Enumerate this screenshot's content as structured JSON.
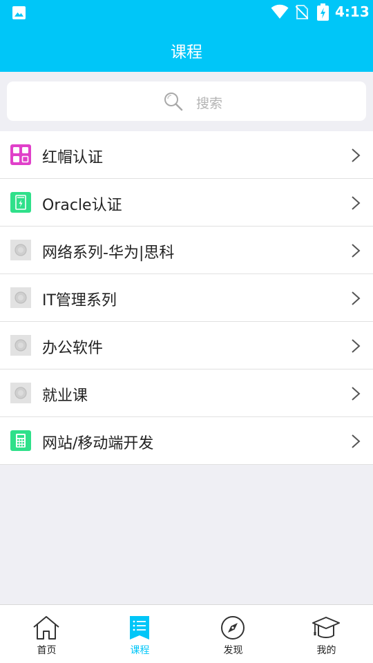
{
  "status_bar": {
    "time": "4:13"
  },
  "header": {
    "title": "课程"
  },
  "search": {
    "placeholder": "搜索"
  },
  "courses": [
    {
      "label": "红帽认证",
      "icon": "redhat-icon"
    },
    {
      "label": "Oracle认证",
      "icon": "oracle-icon"
    },
    {
      "label": "网络系列-华为|思科",
      "icon": "placeholder-icon"
    },
    {
      "label": "IT管理系列",
      "icon": "placeholder-icon"
    },
    {
      "label": "办公软件",
      "icon": "placeholder-icon"
    },
    {
      "label": "就业课",
      "icon": "placeholder-icon"
    },
    {
      "label": "网站/移动端开发",
      "icon": "calculator-icon"
    }
  ],
  "tabbar": {
    "tabs": [
      {
        "label": "首页",
        "icon": "home-icon",
        "active": false
      },
      {
        "label": "课程",
        "icon": "course-list-icon",
        "active": true
      },
      {
        "label": "发现",
        "icon": "compass-icon",
        "active": false
      },
      {
        "label": "我的",
        "icon": "graduation-cap-icon",
        "active": false
      }
    ]
  },
  "colors": {
    "accent": "#00c6f8",
    "background": "#efeff4"
  }
}
